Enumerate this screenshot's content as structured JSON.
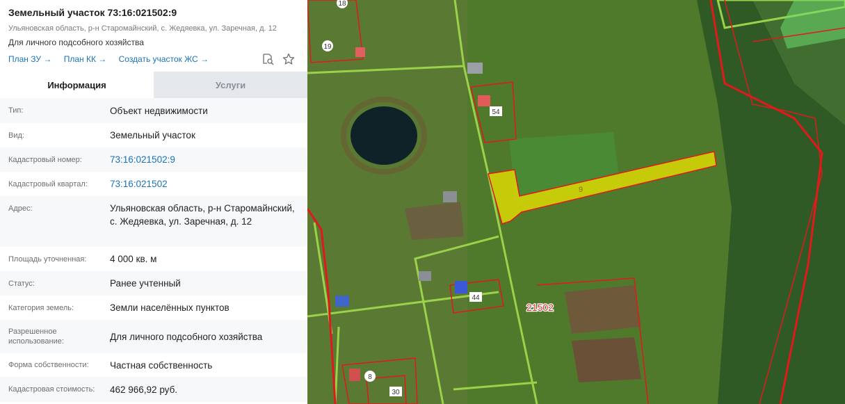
{
  "header": {
    "title": "Земельный участок 73:16:021502:9",
    "address": "Ульяновская область, р-н Старомайнский, с. Жедяевка, ул. Заречная, д. 12",
    "use": "Для личного подсобного хозяйства"
  },
  "links": [
    "План ЗУ →",
    "План КК →",
    "Создать участок ЖС →"
  ],
  "tabs": {
    "info": "Информация",
    "services": "Услуги"
  },
  "rows": [
    {
      "label": "Тип:",
      "value": "Объект недвижимости"
    },
    {
      "label": "Вид:",
      "value": "Земельный участок"
    },
    {
      "label": "Кадастровый номер:",
      "value": "73:16:021502:9"
    },
    {
      "label": "Кадастровый квартал:",
      "value": "73:16:021502"
    },
    {
      "label": "Адрес:",
      "value": "Ульяновская область, р-н Старомайнский, с. Жедяевка, ул. Заречная, д. 12"
    },
    {
      "label": "Площадь уточненная:",
      "value": "4 000 кв. м"
    },
    {
      "label": "Статус:",
      "value": "Ранее учтенный"
    },
    {
      "label": "Категория земель:",
      "value": "Земли населённых пунктов"
    },
    {
      "label": "Разрешенное использование:",
      "value": "Для личного подсобного хозяйства"
    },
    {
      "label": "Форма собственности:",
      "value": "Частная собственность"
    },
    {
      "label": "Кадастровая стоимость:",
      "value": "462 966,92 руб."
    }
  ],
  "map": {
    "parcel_labels": [
      "18",
      "19",
      "54",
      "9",
      "44",
      "8",
      "30"
    ],
    "quarter_label": "21502",
    "colors": {
      "selected_fill": "#e8e000",
      "boundary": "#e01a1a",
      "road": "#9bd24a",
      "link": "#1a73b8"
    }
  }
}
